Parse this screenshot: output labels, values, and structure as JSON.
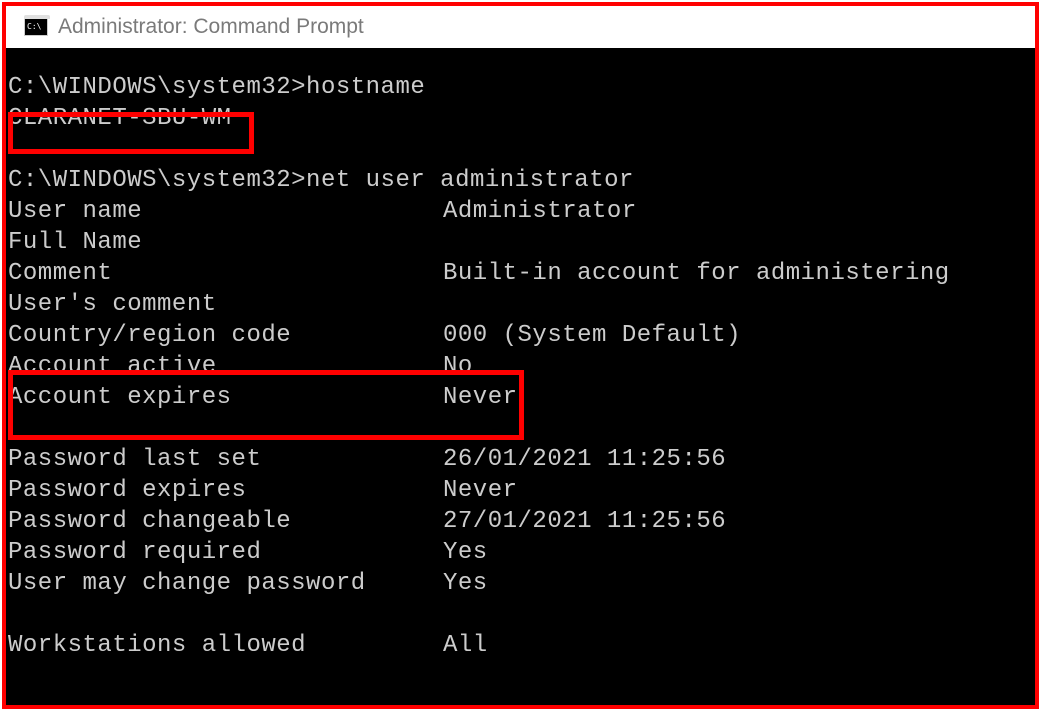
{
  "window": {
    "title": "Administrator: Command Prompt"
  },
  "terminal": {
    "prompt": "C:\\WINDOWS\\system32>",
    "cmd1": "hostname",
    "hostname": "CLARANET-SBU-WM",
    "cmd2": "net user administrator",
    "rows": {
      "user_name": {
        "label": "User name",
        "value": "Administrator"
      },
      "full_name": {
        "label": "Full Name",
        "value": ""
      },
      "comment": {
        "label": "Comment",
        "value": "Built-in account for administering"
      },
      "users_comment": {
        "label": "User's comment",
        "value": ""
      },
      "country_code": {
        "label": "Country/region code",
        "value": "000 (System Default)"
      },
      "account_active": {
        "label": "Account active",
        "value": "No"
      },
      "account_expires": {
        "label": "Account expires",
        "value": "Never"
      },
      "password_last_set": {
        "label": "Password last set",
        "value": "26/01/2021 11:25:56"
      },
      "password_expires": {
        "label": "Password expires",
        "value": "Never"
      },
      "password_changeable": {
        "label": "Password changeable",
        "value": "27/01/2021 11:25:56"
      },
      "password_required": {
        "label": "Password required",
        "value": "Yes"
      },
      "user_may_change": {
        "label": "User may change password",
        "value": "Yes"
      },
      "workstations_allowed": {
        "label": "Workstations allowed",
        "value": "All"
      }
    }
  }
}
